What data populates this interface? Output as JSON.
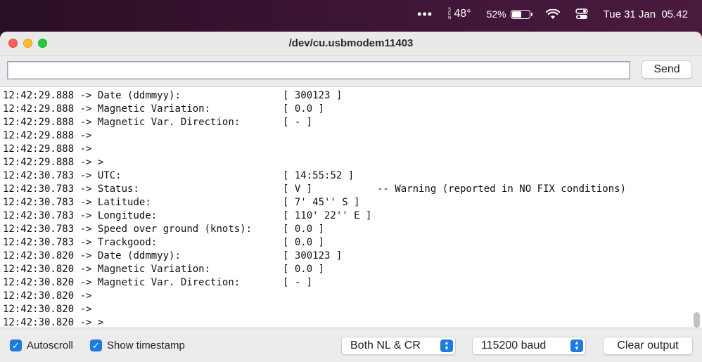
{
  "menubar": {
    "more_icon": "ellipsis-icon",
    "weather_letters": [
      "S",
      "E",
      "N"
    ],
    "temperature": "48°",
    "battery_percent": "52%",
    "battery_level": 0.52,
    "datetime": "Tue 31 Jan  05.42"
  },
  "window": {
    "title": "/dev/cu.usbmodem11403",
    "input_value": "",
    "send_label": "Send"
  },
  "output_lines": [
    {
      "ts": "12:42:29.888",
      "label": "Date (ddmmyy):",
      "value": "[ 300123 ]",
      "note": ""
    },
    {
      "ts": "12:42:29.888",
      "label": "Magnetic Variation:",
      "value": "[ 0.0 ]",
      "note": ""
    },
    {
      "ts": "12:42:29.888",
      "label": "Magnetic Var. Direction:",
      "value": "[ - ]",
      "note": ""
    },
    {
      "ts": "12:42:29.888",
      "label": "",
      "value": "",
      "note": ""
    },
    {
      "ts": "12:42:29.888",
      "label": "",
      "value": "",
      "note": ""
    },
    {
      "ts": "12:42:29.888",
      "label": ">",
      "value": "",
      "note": ""
    },
    {
      "ts": "12:42:30.783",
      "label": "UTC:",
      "value": "[ 14:55:52 ]",
      "note": ""
    },
    {
      "ts": "12:42:30.783",
      "label": "Status:",
      "value": "[ V ]",
      "note": "-- Warning (reported in NO FIX conditions)"
    },
    {
      "ts": "12:42:30.783",
      "label": "Latitude:",
      "value": "[ 7' 45'' S ]",
      "note": ""
    },
    {
      "ts": "12:42:30.783",
      "label": "Longitude:",
      "value": "[ 110' 22'' E ]",
      "note": ""
    },
    {
      "ts": "12:42:30.783",
      "label": "Speed over ground (knots):",
      "value": "[ 0.0 ]",
      "note": ""
    },
    {
      "ts": "12:42:30.783",
      "label": "Trackgood:",
      "value": "[ 0.0 ]",
      "note": ""
    },
    {
      "ts": "12:42:30.820",
      "label": "Date (ddmmyy):",
      "value": "[ 300123 ]",
      "note": ""
    },
    {
      "ts": "12:42:30.820",
      "label": "Magnetic Variation:",
      "value": "[ 0.0 ]",
      "note": ""
    },
    {
      "ts": "12:42:30.820",
      "label": "Magnetic Var. Direction:",
      "value": "[ - ]",
      "note": ""
    },
    {
      "ts": "12:42:30.820",
      "label": "",
      "value": "",
      "note": ""
    },
    {
      "ts": "12:42:30.820",
      "label": "",
      "value": "",
      "note": ""
    },
    {
      "ts": "12:42:30.820",
      "label": ">",
      "value": "",
      "note": ""
    }
  ],
  "arrow": "->",
  "footer": {
    "autoscroll_label": "Autoscroll",
    "autoscroll_checked": true,
    "timestamp_label": "Show timestamp",
    "timestamp_checked": true,
    "line_ending": "Both NL & CR",
    "baud": "115200 baud",
    "clear_label": "Clear output"
  },
  "colors": {
    "accent": "#1f7ae0",
    "close": "#fe5f57",
    "minimize": "#febc2e",
    "zoom": "#28c840"
  }
}
